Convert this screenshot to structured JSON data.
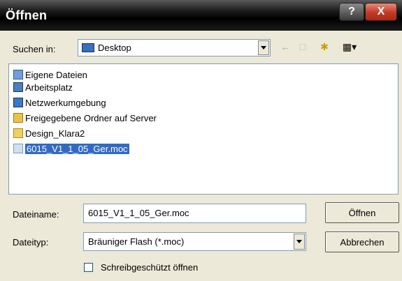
{
  "window": {
    "title": "Öffnen",
    "help_label": "?",
    "close_label": "X"
  },
  "lookin": {
    "label": "Suchen in:",
    "value": "Desktop"
  },
  "icons": [
    "back-arrow-icon",
    "up-folder-icon",
    "new-folder-icon",
    "view-menu-icon"
  ],
  "files": [
    {
      "name": "Eigene Dateien",
      "icon": "my-documents-icon",
      "color": "#6fa0d8",
      "selected": false
    },
    {
      "name": "Arbeitsplatz",
      "icon": "my-computer-icon",
      "color": "#4a7fc0",
      "selected": false
    },
    {
      "name": "Netzwerkumgebung",
      "icon": "network-icon",
      "color": "#3b78c7",
      "selected": false
    },
    {
      "name": "Freigegebene Ordner auf Server",
      "icon": "shared-folder-icon",
      "color": "#e8c24a",
      "selected": false
    },
    {
      "name": "Design_Klara2",
      "icon": "folder-icon",
      "color": "#f0d060",
      "selected": false
    },
    {
      "name": "6015_V1_1_05_Ger.moc",
      "icon": "file-icon",
      "color": "#cfe0f5",
      "selected": true
    }
  ],
  "filename": {
    "label": "Dateiname:",
    "value": "6015_V1_1_05_Ger.moc"
  },
  "filetype": {
    "label": "Dateityp:",
    "value": "Bräuniger Flash (*.moc)"
  },
  "buttons": {
    "open": "Öffnen",
    "cancel": "Abbrechen"
  },
  "readonly": {
    "label": "Schreibgeschützt öffnen",
    "checked": false
  },
  "colors": {
    "selection": "#316ac5",
    "dialog_bg": "#ece9d8"
  }
}
